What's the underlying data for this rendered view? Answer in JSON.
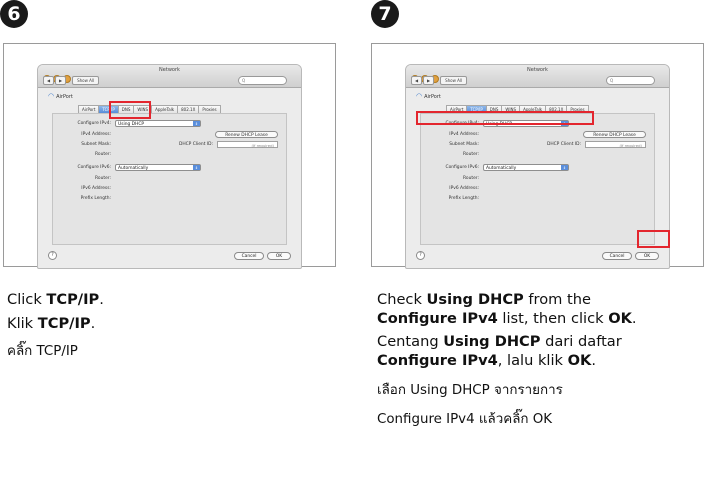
{
  "steps": [
    {
      "number": "6",
      "window": {
        "title": "Network",
        "show_all": "Show All",
        "nav_back": "◀",
        "nav_forward": "▶",
        "search_placeholder": "Q",
        "network_name": "AirPort",
        "tabs": [
          "AirPort",
          "TCP/IP",
          "DNS",
          "WINS",
          "AppleTalk",
          "802.1X",
          "Proxies"
        ],
        "active_tab": "TCP/IP",
        "configure_ipv4_label": "Configure IPv4:",
        "configure_ipv4_value": "Using DHCP",
        "ipv4_address_label": "IPv4 Address:",
        "renew_button": "Renew DHCP Lease",
        "subnet_mask_label": "Subnet Mask:",
        "dhcp_client_id_label": "DHCP Client ID:",
        "if_required": "(If required)",
        "router_label": "Router:",
        "configure_ipv6_label": "Configure IPv6:",
        "configure_ipv6_value": "Automatically",
        "router6_label": "Router:",
        "ipv6_address_label": "IPv6 Address:",
        "prefix_length_label": "Prefix Length:",
        "help": "?",
        "cancel_button": "Cancel",
        "ok_button": "OK"
      },
      "caption": {
        "en_pre": "Click ",
        "en_bold": "TCP/IP",
        "en_post": ".",
        "id_pre": "Klik ",
        "id_bold": "TCP/IP",
        "id_post": ".",
        "th": "คลิ๊ก  TCP/IP"
      }
    },
    {
      "number": "7",
      "window": {
        "title": "Network",
        "show_all": "Show All",
        "nav_back": "◀",
        "nav_forward": "▶",
        "search_placeholder": "Q",
        "network_name": "AirPort",
        "tabs": [
          "AirPort",
          "TCP/IP",
          "DNS",
          "WINS",
          "AppleTalk",
          "802.1X",
          "Proxies"
        ],
        "active_tab": "TCP/IP",
        "configure_ipv4_label": "Configure IPv4:",
        "configure_ipv4_value": "Using DHCP",
        "ipv4_address_label": "IPv4 Address:",
        "renew_button": "Renew DHCP Lease",
        "subnet_mask_label": "Subnet Mask:",
        "dhcp_client_id_label": "DHCP Client ID:",
        "if_required": "(If required)",
        "router_label": "Router:",
        "configure_ipv6_label": "Configure IPv6:",
        "configure_ipv6_value": "Automatically",
        "router6_label": "Router:",
        "ipv6_address_label": "IPv6 Address:",
        "prefix_length_label": "Prefix Length:",
        "help": "?",
        "cancel_button": "Cancel",
        "ok_button": "OK"
      },
      "caption": {
        "en_1_pre": "Check ",
        "en_1_bold": "Using DHCP",
        "en_1_post": " from the",
        "en_2_bold_a": "Configure IPv4",
        "en_2_mid": " list, then click ",
        "en_2_bold_b": "OK",
        "en_2_post": ".",
        "id_1_pre": "Centang ",
        "id_1_bold": "Using DHCP",
        "id_1_post": " dari daftar",
        "id_2_bold_a": "Configure IPv4",
        "id_2_mid": ", lalu klik ",
        "id_2_bold_b": "OK",
        "id_2_post": ".",
        "th_1": "เลือก  Using DHCP  จากรายการ",
        "th_2": "Configure IPv4  แล้วคลิ๊ก  OK"
      }
    }
  ],
  "highlight_color": "#e3262e"
}
